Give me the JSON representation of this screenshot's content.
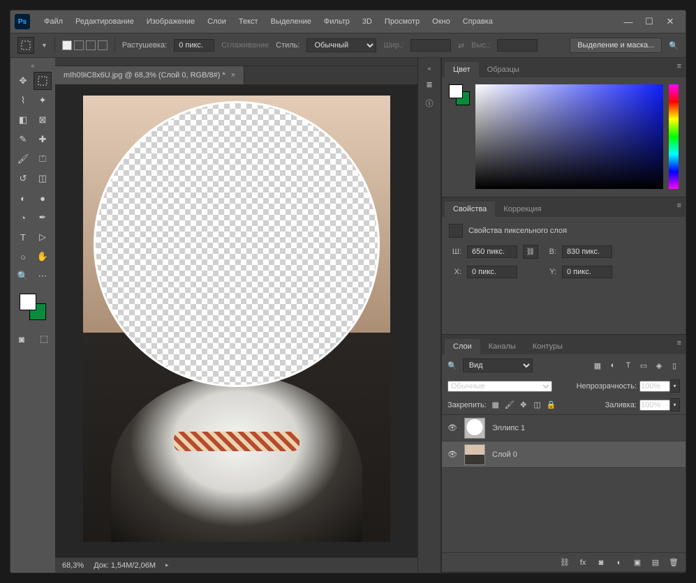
{
  "menu": {
    "file": "Файл",
    "edit": "Редактирование",
    "image": "Изображение",
    "layer": "Слои",
    "type": "Текст",
    "select": "Выделение",
    "filter": "Фильтр",
    "d3": "3D",
    "view": "Просмотр",
    "window": "Окно",
    "help": "Справка"
  },
  "optbar": {
    "feather_label": "Растушевка:",
    "feather_value": "0 пикс.",
    "antialias": "Сглаживание",
    "style_label": "Стиль:",
    "style_value": "Обычный",
    "width_label": "Шир.:",
    "height_label": "Выс.:",
    "mask_btn": "Выделение и маска..."
  },
  "doctab": {
    "title": "mIh09iC8x6U.jpg @ 68,3% (Слой 0, RGB/8#) *"
  },
  "status": {
    "zoom": "68,3%",
    "doc": "Док: 1,54M/2,06M"
  },
  "panels": {
    "color": {
      "tab_color": "Цвет",
      "tab_swatches": "Образцы"
    },
    "props": {
      "tab_props": "Свойства",
      "tab_adjust": "Коррекция",
      "heading": "Свойства пиксельного слоя",
      "w_label": "Ш:",
      "w_value": "650 пикс.",
      "h_label": "В:",
      "h_value": "830 пикс.",
      "x_label": "X:",
      "x_value": "0 пикс.",
      "y_label": "Y:",
      "y_value": "0 пикс."
    },
    "layers": {
      "tab_layers": "Слои",
      "tab_channels": "Каналы",
      "tab_paths": "Контуры",
      "kind": "Вид",
      "blend": "Обычные",
      "opacity_label": "Непрозрачность:",
      "opacity": "100%",
      "lock_label": "Закрепить:",
      "fill_label": "Заливка:",
      "fill": "100%",
      "items": [
        {
          "name": "Эллипс 1"
        },
        {
          "name": "Слой 0"
        }
      ]
    }
  },
  "search_icon": "🔍"
}
